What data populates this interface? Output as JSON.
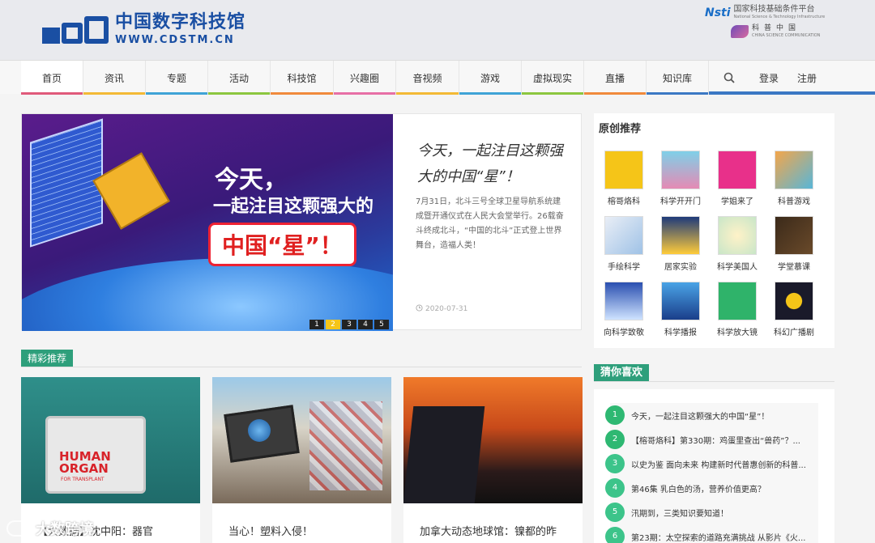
{
  "header": {
    "logo_cn": "中国数字科技馆",
    "logo_en": "WWW.CDSTM.CN",
    "partner1_mark": "Nsti",
    "partner1_cn": "国家科技基础条件平台",
    "partner1_en": "National Science & Technology Infrastructure",
    "partner2_cn": "科普中国",
    "partner2_en": "CHINA SCIENCE COMMUNICATION"
  },
  "nav": {
    "items": [
      {
        "label": "首页",
        "color": "#e05a7a"
      },
      {
        "label": "资讯",
        "color": "#f3b935"
      },
      {
        "label": "专题",
        "color": "#3fa3d6"
      },
      {
        "label": "活动",
        "color": "#8cc63f"
      },
      {
        "label": "科技馆",
        "color": "#f08a3c"
      },
      {
        "label": "兴趣圈",
        "color": "#e76fa6"
      },
      {
        "label": "音视频",
        "color": "#f3b935"
      },
      {
        "label": "游戏",
        "color": "#3fa3d6"
      },
      {
        "label": "虚拟现实",
        "color": "#8cc63f"
      },
      {
        "label": "直播",
        "color": "#f08a3c"
      },
      {
        "label": "知识库",
        "color": "#3b78c4"
      }
    ],
    "login": "登录",
    "register": "注册"
  },
  "hero": {
    "image_line1": "今天，",
    "image_line2": "一起注目这颗强大的",
    "image_line3": "中国“星”！",
    "title": "今天，一起注目这颗强大的中国“星”！",
    "description": "7月31日，北斗三号全球卫星导航系统建成暨开通仪式在人民大会堂举行。26载奋斗终成北斗，“中国的北斗”正式登上世界舞台，造福人类！",
    "date": "2020-07-31",
    "pages": [
      "1",
      "2",
      "3",
      "4",
      "5"
    ]
  },
  "original": {
    "title": "原创推荐",
    "items": [
      {
        "label": "榕哥烙科"
      },
      {
        "label": "科学开开门"
      },
      {
        "label": "学姐来了"
      },
      {
        "label": "科普游戏"
      },
      {
        "label": "手绘科学"
      },
      {
        "label": "居家实验"
      },
      {
        "label": "科学美国人"
      },
      {
        "label": "学堂慕课"
      },
      {
        "label": "向科学致敬"
      },
      {
        "label": "科学播报"
      },
      {
        "label": "科学放大镜"
      },
      {
        "label": "科幻广播剧"
      }
    ]
  },
  "featured": {
    "tag": "精彩推荐",
    "cards": [
      {
        "title": "【大数据】沈中阳：器官",
        "image_text": "HUMAN ORGAN",
        "image_sub": "FOR TRANSPLANT"
      },
      {
        "title": "当心！塑料入侵！"
      },
      {
        "title": "加拿大动态地球馆：镍都的昨"
      }
    ]
  },
  "like": {
    "tag": "猜你喜欢",
    "items": [
      {
        "num": "1",
        "text": "今天，一起注目这颗强大的中国“星”！"
      },
      {
        "num": "2",
        "text": "【榕哥烙科】第330期：鸡蛋里查出“兽药”？..."
      },
      {
        "num": "3",
        "text": "以史为鉴 面向未来 构建新时代普惠创新的科普..."
      },
      {
        "num": "4",
        "text": "第46集 乳白色的汤，营养价值更高？"
      },
      {
        "num": "5",
        "text": "汛期到，三类知识要知道！"
      },
      {
        "num": "6",
        "text": "第23期：太空探索的道路充满挑战 从影片《火..."
      }
    ]
  },
  "watermark": "大数跨境"
}
